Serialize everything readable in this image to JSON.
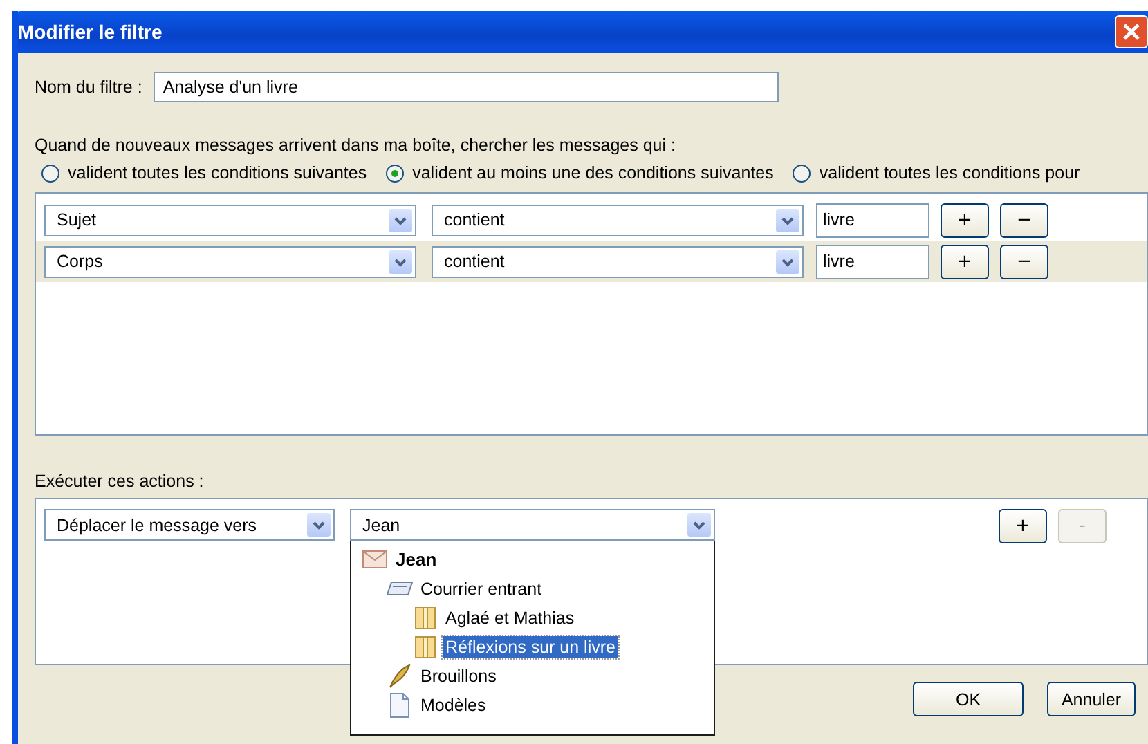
{
  "window": {
    "title": "Modifier le filtre"
  },
  "filter_name": {
    "label": "Nom du filtre :",
    "value": "Analyse d'un livre"
  },
  "match": {
    "prompt": "Quand de nouveaux messages arrivent dans ma boîte, chercher les messages qui :",
    "options": [
      {
        "label": "valident toutes les conditions suivantes",
        "selected": false
      },
      {
        "label": "valident au moins une des conditions suivantes",
        "selected": true
      },
      {
        "label": "valident toutes les conditions pour",
        "selected": false
      }
    ]
  },
  "conditions": [
    {
      "field": "Sujet",
      "operator": "contient",
      "value": "livre",
      "add": "+",
      "remove": "−",
      "selected": false
    },
    {
      "field": "Corps",
      "operator": "contient",
      "value": "livre",
      "add": "+",
      "remove": "−",
      "selected": true
    }
  ],
  "actions": {
    "label": "Exécuter ces actions :",
    "rows": [
      {
        "action": "Déplacer le message vers",
        "target": "Jean",
        "add": "+",
        "remove": "-",
        "remove_disabled": true
      }
    ]
  },
  "folder_menu": [
    {
      "label": "Jean",
      "kind": "account",
      "selected": false,
      "children": [
        {
          "label": "Courrier entrant",
          "kind": "inbox",
          "selected": false,
          "children": [
            {
              "label": "Aglaé et Mathias",
              "kind": "folder",
              "selected": false
            },
            {
              "label": "Réflexions sur un livre",
              "kind": "folder",
              "selected": true
            }
          ]
        },
        {
          "label": "Brouillons",
          "kind": "drafts",
          "selected": false
        },
        {
          "label": "Modèles",
          "kind": "templates",
          "selected": false
        }
      ]
    }
  ],
  "buttons": [
    "OK",
    "Annuler"
  ]
}
